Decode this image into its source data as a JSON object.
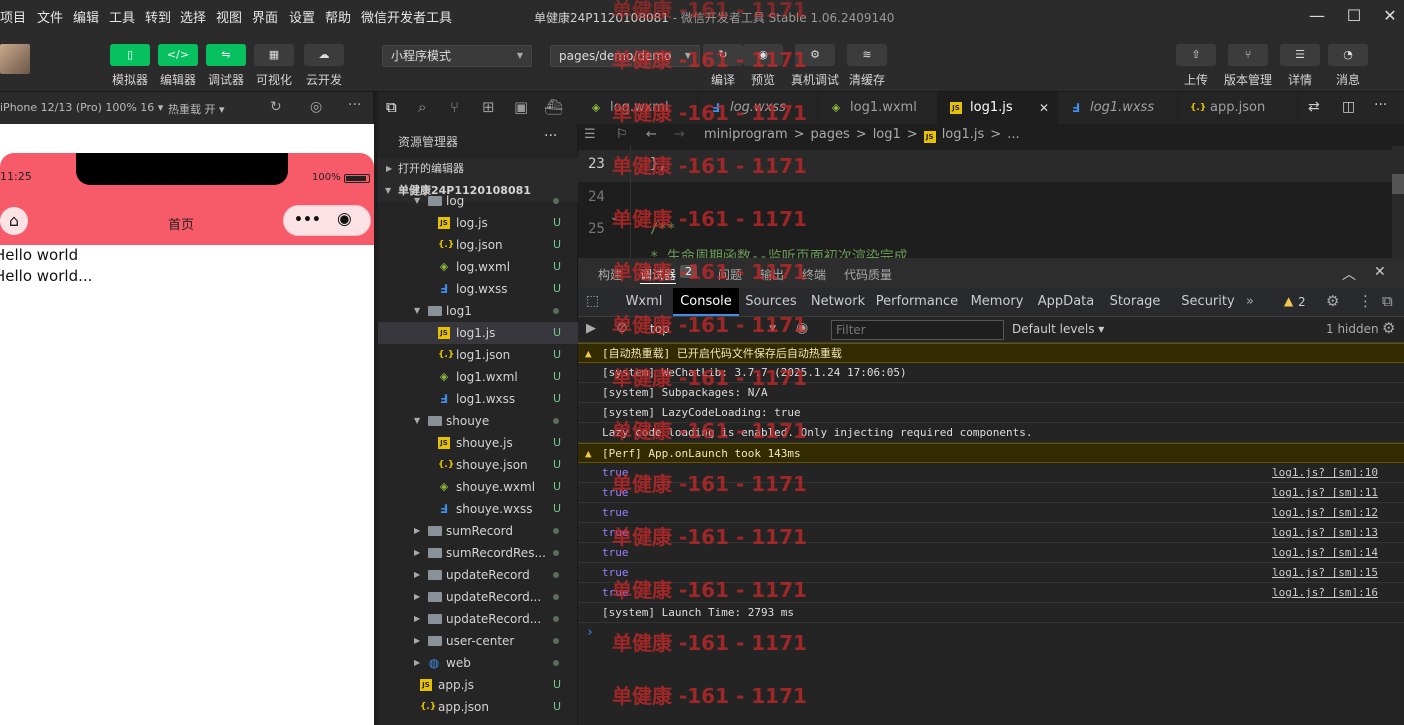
{
  "menu": [
    "项目",
    "文件",
    "编辑",
    "工具",
    "转到",
    "选择",
    "视图",
    "界面",
    "设置",
    "帮助",
    "微信开发者工具"
  ],
  "window": {
    "project": "单健康24P1120108081",
    "sep": " - ",
    "app": "微信开发者工具 Stable 1.06.2409140"
  },
  "toolbar": {
    "left": [
      "模拟器",
      "编辑器",
      "调试器",
      "可视化",
      "云开发"
    ],
    "mode_select": "小程序模式",
    "page_select": "pages/demo/demo",
    "middle": [
      "编译",
      "预览",
      "真机调试",
      "清缓存"
    ],
    "right": [
      "上传",
      "版本管理",
      "详情",
      "消息"
    ]
  },
  "sim": {
    "device": "iPhone 12/13 (Pro) 100% 16",
    "hotreload": "热重载 开",
    "time": "11:25",
    "battery": "100%",
    "nav_title": "首页",
    "lines": [
      "Hello world",
      "Hello world..."
    ]
  },
  "explorer": {
    "title": "资源管理器",
    "open_editors": "打开的编辑器",
    "project": "单健康24P1120108081",
    "items": [
      {
        "name": "log",
        "type": "folder",
        "indent": 1,
        "open": true,
        "status": "dot"
      },
      {
        "name": "log.js",
        "type": "js",
        "indent": 2,
        "status": "U"
      },
      {
        "name": "log.json",
        "type": "json",
        "indent": 2,
        "status": "U"
      },
      {
        "name": "log.wxml",
        "type": "wxml",
        "indent": 2,
        "status": "U"
      },
      {
        "name": "log.wxss",
        "type": "wxss",
        "indent": 2,
        "status": "U"
      },
      {
        "name": "log1",
        "type": "folder",
        "indent": 1,
        "open": true,
        "status": "dot"
      },
      {
        "name": "log1.js",
        "type": "js",
        "indent": 2,
        "status": "U",
        "selected": true
      },
      {
        "name": "log1.json",
        "type": "json",
        "indent": 2,
        "status": "U"
      },
      {
        "name": "log1.wxml",
        "type": "wxml",
        "indent": 2,
        "status": "U"
      },
      {
        "name": "log1.wxss",
        "type": "wxss",
        "indent": 2,
        "status": "U"
      },
      {
        "name": "shouye",
        "type": "folder",
        "indent": 1,
        "open": true,
        "status": "dot"
      },
      {
        "name": "shouye.js",
        "type": "js",
        "indent": 2,
        "status": "U"
      },
      {
        "name": "shouye.json",
        "type": "json",
        "indent": 2,
        "status": "U"
      },
      {
        "name": "shouye.wxml",
        "type": "wxml",
        "indent": 2,
        "status": "U"
      },
      {
        "name": "shouye.wxss",
        "type": "wxss",
        "indent": 2,
        "status": "U"
      },
      {
        "name": "sumRecord",
        "type": "folder",
        "indent": 1,
        "status": "dot"
      },
      {
        "name": "sumRecordRes...",
        "type": "folder",
        "indent": 1,
        "status": "dot"
      },
      {
        "name": "updateRecord",
        "type": "folder",
        "indent": 1,
        "status": "dot"
      },
      {
        "name": "updateRecord...",
        "type": "folder",
        "indent": 1,
        "status": "dot"
      },
      {
        "name": "updateRecord...",
        "type": "folder",
        "indent": 1,
        "status": "dot"
      },
      {
        "name": "user-center",
        "type": "folder",
        "indent": 1,
        "status": "dot"
      },
      {
        "name": "web",
        "type": "web",
        "indent": 1,
        "status": "dot"
      },
      {
        "name": "app.js",
        "type": "js",
        "indent": 0,
        "status": "U"
      },
      {
        "name": "app.json",
        "type": "json",
        "indent": 0,
        "status": "U"
      }
    ]
  },
  "editor_tabs": [
    {
      "name": "log.wxml",
      "type": "wxml"
    },
    {
      "name": "log.wxss",
      "type": "wxss"
    },
    {
      "name": "log1.wxml",
      "type": "wxml"
    },
    {
      "name": "log1.js",
      "type": "js",
      "active": true
    },
    {
      "name": "log1.wxss",
      "type": "wxss"
    },
    {
      "name": "app.json",
      "type": "json"
    }
  ],
  "breadcrumb": [
    "miniprogram",
    ">",
    "pages",
    ">",
    "log1",
    ">",
    "log1.js",
    ">",
    "..."
  ],
  "code": [
    {
      "ln": "23",
      "text": "},"
    },
    {
      "ln": "24",
      "text": ""
    },
    {
      "ln": "25",
      "text": "/**"
    },
    {
      "ln": "",
      "text": " * 生命周期函数--监听页面初次渲染完成"
    }
  ],
  "devtools_top": {
    "tabs": [
      "构建",
      "调试器",
      "问题",
      "输出",
      "终端",
      "代码质量"
    ],
    "badge": "2"
  },
  "panels": [
    "Wxml",
    "Console",
    "Sources",
    "Network",
    "Performance",
    "Memory",
    "AppData",
    "Storage",
    "Security"
  ],
  "warn_count": "2",
  "console_bar": {
    "context": "top",
    "filter_placeholder": "Filter",
    "levels": "Default levels",
    "hidden": "1 hidden"
  },
  "console_rows": [
    {
      "text": "[自动热重载] 已开启代码文件保存后自动热重载",
      "warn": true
    },
    {
      "text": "[system] WeChatLib: 3.7.7 (2025.1.24 17:06:05)"
    },
    {
      "text": "[system] Subpackages: N/A"
    },
    {
      "text": "[system] LazyCodeLoading: true"
    },
    {
      "text": "Lazy code loading is enabled. Only injecting required components."
    },
    {
      "text": "[Perf] App.onLaunch took 143ms",
      "warn": true
    },
    {
      "text": "true",
      "src": "log1.js? [sm]:10",
      "val": true
    },
    {
      "text": "true",
      "src": "log1.js? [sm]:11",
      "val": true
    },
    {
      "text": "true",
      "src": "log1.js? [sm]:12",
      "val": true
    },
    {
      "text": "true",
      "src": "log1.js? [sm]:13",
      "val": true
    },
    {
      "text": "true",
      "src": "log1.js? [sm]:14",
      "val": true
    },
    {
      "text": "true",
      "src": "log1.js? [sm]:15",
      "val": true
    },
    {
      "text": "true",
      "src": "log1.js? [sm]:16",
      "val": true
    },
    {
      "text": "[system] Launch Time: 2793 ms"
    }
  ],
  "watermark": "单健康 -161 - 1171",
  "colors": {
    "accent": "#07c160",
    "phone_header": "#f75b6a",
    "warning": "#f2c94c"
  }
}
